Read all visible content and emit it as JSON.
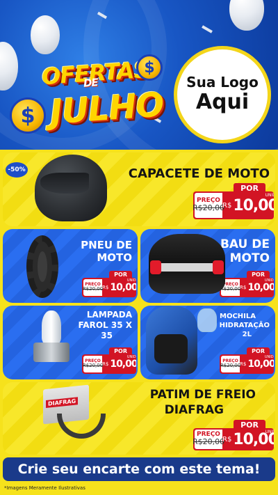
{
  "header": {
    "headline_top": "OFERTAS",
    "headline_mid": "DE",
    "headline_bottom": "JULHO",
    "coin_symbol": "$",
    "logo_line1": "Sua Logo",
    "logo_line2": "Aqui"
  },
  "price_labels": {
    "old_label": "PREÇO",
    "por": "POR",
    "currency": "R$",
    "unit": "UNID"
  },
  "products": {
    "capacete": {
      "title": "CAPACETE DE MOTO",
      "badge": "-50%",
      "old_price": "R$20,00",
      "new_price": "10,00"
    },
    "pneu": {
      "title_line1": "PNEU DE",
      "title_line2": "MOTO",
      "old_price": "R$20,00",
      "new_price": "10,00"
    },
    "bau": {
      "title_line1": "BAU DE",
      "title_line2": "MOTO",
      "old_price": "R$20,00",
      "new_price": "10,00"
    },
    "lampada": {
      "title_line1": "LAMPADA",
      "title_line2": "FAROL 35 X",
      "title_line3": "35",
      "old_price": "R$20,00",
      "new_price": "10,00"
    },
    "mochila": {
      "title_line1": "MOCHILA",
      "title_line2": "HIDRATAÇÃO",
      "title_line3": "2L",
      "old_price": "R$20,00",
      "new_price": "10,00"
    },
    "patim": {
      "title_line1": "PATIM DE FREIO",
      "title_line2": "DIAFRAG",
      "brand": "DIAFRAG",
      "old_price": "R$20,00",
      "new_price": "10,00"
    }
  },
  "footer": {
    "cta": "Crie seu encarte com este tema!",
    "disclaimer": "*Imagens Meramente Ilustrativas"
  },
  "colors": {
    "header_blue": "#1856c4",
    "yellow": "#f8e72a",
    "card_blue": "#2a6ef0",
    "price_red": "#d21424",
    "cta_navy": "#1a3a8a"
  }
}
